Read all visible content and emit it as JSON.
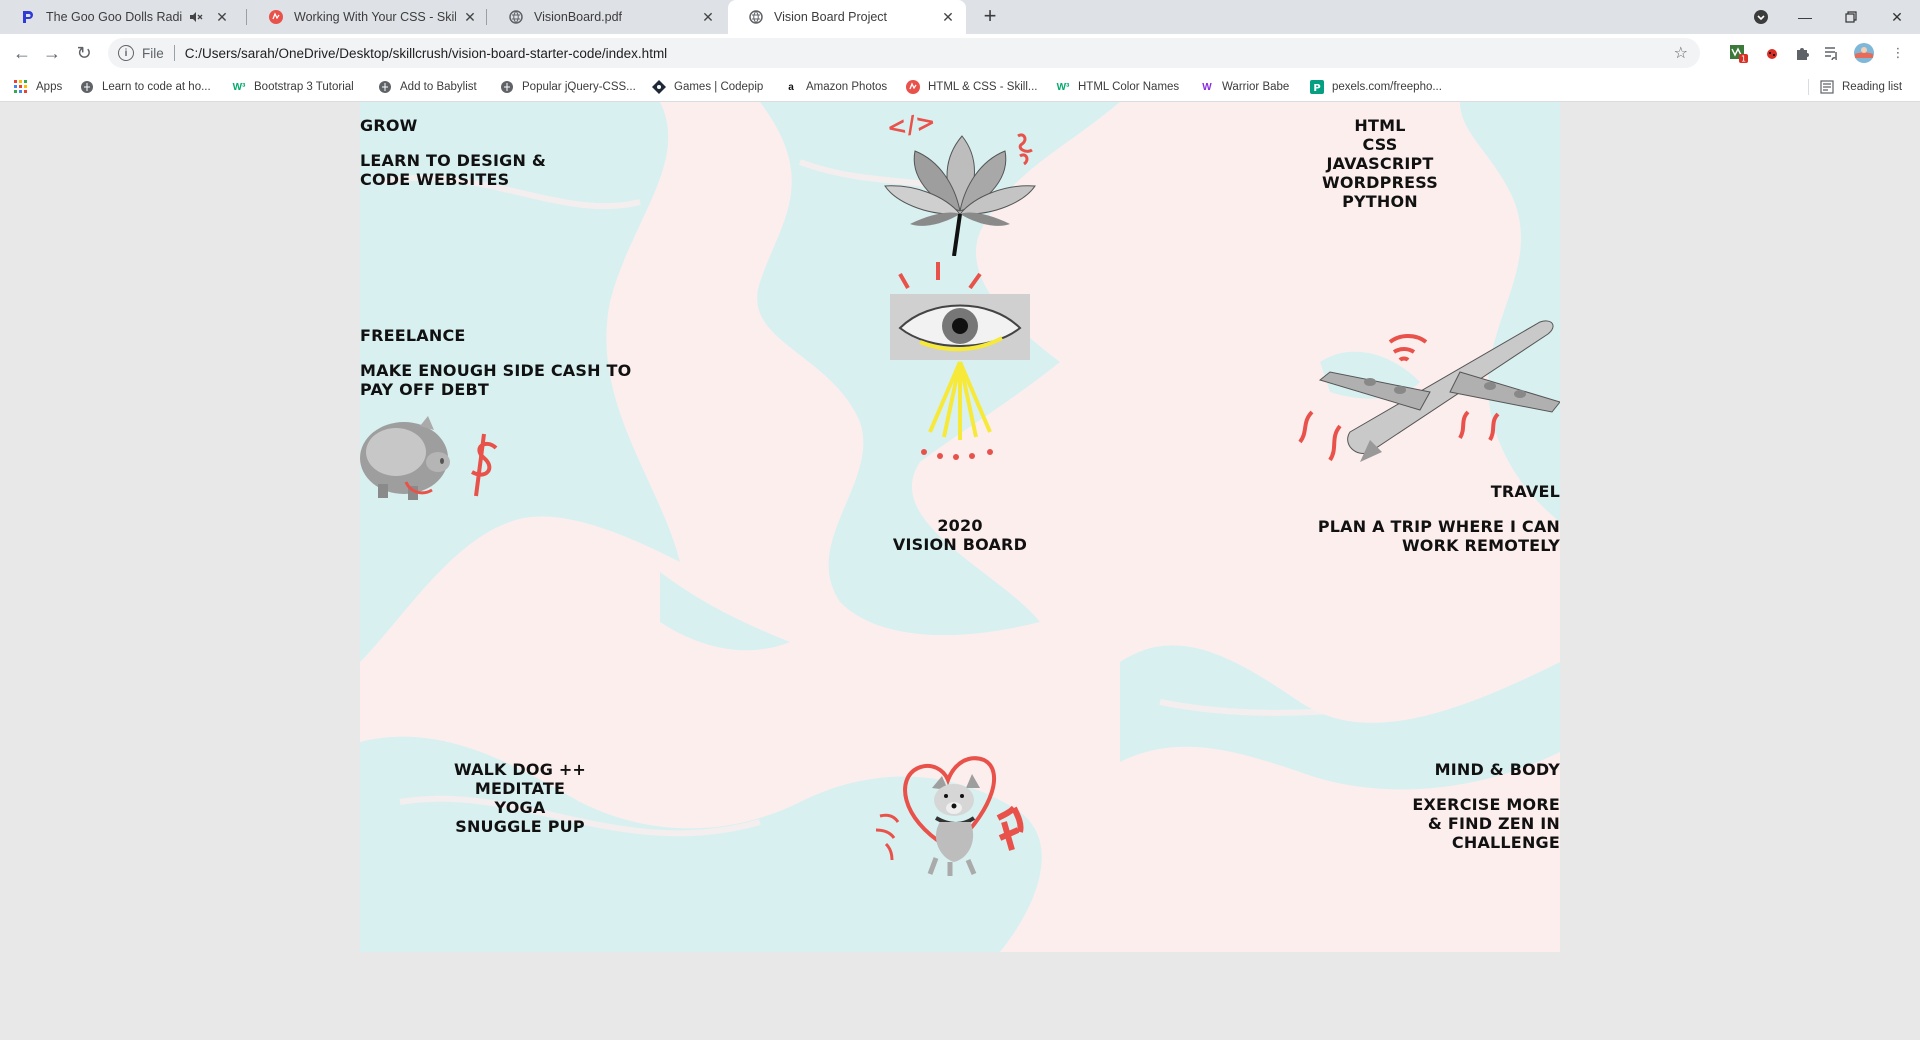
{
  "tabs": [
    {
      "title": "The Goo Goo Dolls Radio - M",
      "icon": "pandora-icon",
      "muted": true
    },
    {
      "title": "Working With Your CSS - Skillcrush",
      "icon": "skillcrush-icon"
    },
    {
      "title": "VisionBoard.pdf",
      "icon": "globe-icon"
    },
    {
      "title": "Vision Board Project",
      "icon": "globe-icon",
      "active": true
    }
  ],
  "toolbar": {
    "scheme": "File",
    "url": "C:/Users/sarah/OneDrive/Desktop/skillcrush/vision-board-starter-code/index.html",
    "extension_badge": "1"
  },
  "bookmarks": [
    {
      "label": "Apps",
      "icon": "apps-grid-icon"
    },
    {
      "label": "Learn to code at ho...",
      "icon": "globe-icon"
    },
    {
      "label": "Bootstrap 3 Tutorial",
      "icon": "w3schools-icon"
    },
    {
      "label": "Add to Babylist",
      "icon": "globe-icon"
    },
    {
      "label": "Popular jQuery-CSS...",
      "icon": "globe-icon"
    },
    {
      "label": "Games | Codepip",
      "icon": "codepip-icon"
    },
    {
      "label": "Amazon Photos",
      "icon": "amazon-icon"
    },
    {
      "label": "HTML & CSS - Skill...",
      "icon": "skillcrush-icon"
    },
    {
      "label": "HTML Color Names",
      "icon": "w3schools-icon"
    },
    {
      "label": "Warrior Babe",
      "icon": "wb-icon"
    },
    {
      "label": "pexels.com/freepho...",
      "icon": "pexels-icon"
    }
  ],
  "reading_list": "Reading list",
  "board": {
    "grow": {
      "heading": "GROW",
      "lines": [
        "LEARN TO DESIGN &",
        "CODE WEBSITES"
      ]
    },
    "skills": [
      "HTML",
      "CSS",
      "JAVASCRIPT",
      "WORDPRESS",
      "PYTHON"
    ],
    "freelance": {
      "heading": "FREELANCE",
      "lines": [
        "MAKE ENOUGH SIDE CASH TO",
        "PAY OFF DEBT"
      ]
    },
    "title": [
      "2020",
      "VISION BOARD"
    ],
    "travel": {
      "heading": "TRAVEL",
      "lines": [
        "PLAN A TRIP WHERE I CAN",
        "WORK REMOTELY"
      ]
    },
    "routine": [
      "WALK DOG ++",
      "MEDITATE",
      "YOGA",
      "SNUGGLE PUP"
    ],
    "mind_body": {
      "heading": "MIND & BODY",
      "lines": [
        "EXERCISE MORE",
        "& FIND ZEN IN",
        "CHALLENGE"
      ]
    },
    "doodle_text": "</>"
  },
  "colors": {
    "mint": "#d8f0f0",
    "blush": "#fdeeee",
    "accent_red": "#e8524a",
    "accent_yellow": "#f7e93a",
    "text": "#111111"
  }
}
